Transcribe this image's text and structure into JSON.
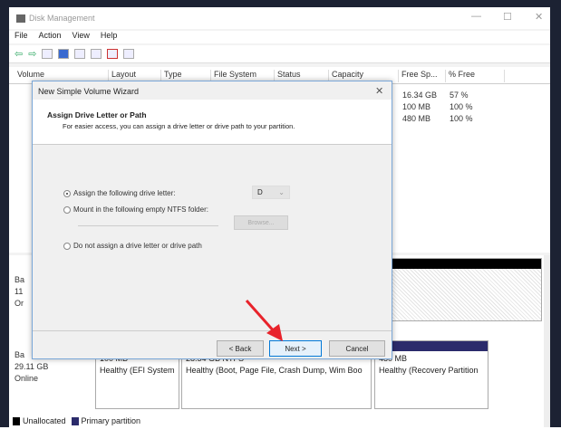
{
  "window": {
    "title": "Disk Management",
    "minimize": "—",
    "maximize": "☐",
    "close": "✕"
  },
  "menu": [
    "File",
    "Action",
    "View",
    "Help"
  ],
  "columns": [
    "Volume",
    "Layout",
    "Type",
    "File System",
    "Status",
    "Capacity",
    "Free Sp...",
    "% Free"
  ],
  "rows": [
    {
      "free": "16.34 GB",
      "pct": "57 %"
    },
    {
      "free": "100 MB",
      "pct": "100 %"
    },
    {
      "free": "480 MB",
      "pct": "100 %"
    }
  ],
  "disk0": {
    "label1": "Ba",
    "label2": "11",
    "label3": "Or"
  },
  "disk1": {
    "label1": "Ba",
    "size": "29.11 GB",
    "status": "Online",
    "partitions": [
      {
        "size": "100 MB",
        "status": "Healthy (EFI System"
      },
      {
        "size": "28.54 GB NTFS",
        "status": "Healthy (Boot, Page File, Crash Dump, Wim Boo"
      },
      {
        "size": "480 MB",
        "status": "Healthy (Recovery Partition"
      }
    ]
  },
  "legend": {
    "unallocated": "Unallocated",
    "primary": "Primary partition",
    "colors": {
      "unallocated": "#000000",
      "primary": "#2b2b6b"
    }
  },
  "wizard": {
    "title": "New Simple Volume Wizard",
    "close": "✕",
    "heading": "Assign Drive Letter or Path",
    "subheading": "For easier access, you can assign a drive letter or drive path to your partition.",
    "option1": "Assign the following drive letter:",
    "option2": "Mount in the following empty NTFS folder:",
    "option3": "Do not assign a drive letter or drive path",
    "drive_letter": "D",
    "browse": "Browse...",
    "back": "< Back",
    "next": "Next >",
    "cancel": "Cancel"
  }
}
